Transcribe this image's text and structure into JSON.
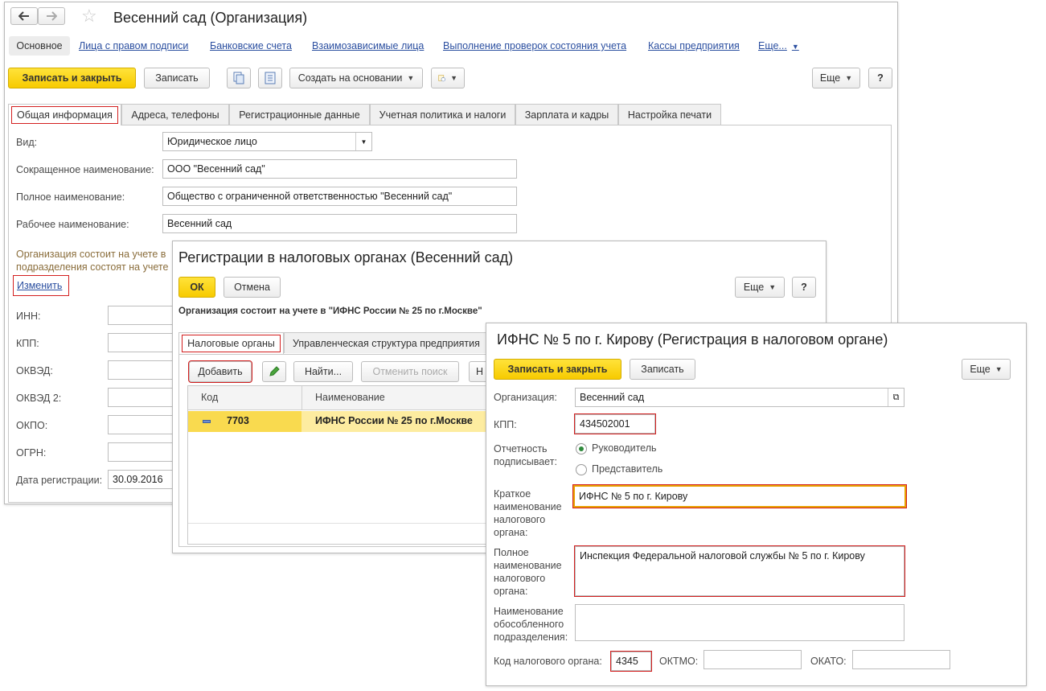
{
  "main": {
    "title": "Весенний сад (Организация)",
    "nav_links": [
      "Основное",
      "Лица с правом подписи",
      "Банковские счета",
      "Взаимозависимые лица",
      "Выполнение проверок состояния учета",
      "Кассы предприятия",
      "Еще..."
    ],
    "toolbar": {
      "save_close": "Записать и закрыть",
      "save": "Записать",
      "create_based": "Создать на основании",
      "more": "Еще",
      "help": "?"
    },
    "tabs": [
      "Общая информация",
      "Адреса, телефоны",
      "Регистрационные данные",
      "Учетная политика и налоги",
      "Зарплата и кадры",
      "Настройка печати"
    ],
    "form": {
      "kind_label": "Вид:",
      "kind_value": "Юридическое лицо",
      "short_name_label": "Сокращенное наименование:",
      "short_name_value": "ООО \"Весенний сад\"",
      "full_name_label": "Полное наименование:",
      "full_name_value": "Общество с ограниченной ответственностью \"Весенний сад\"",
      "work_name_label": "Рабочее наименование:",
      "work_name_value": "Весенний сад",
      "tax_note_line1": "Организация состоит на учете в",
      "tax_note_line2": "подразделения состоят на учете",
      "change_link": "Изменить",
      "inn_label": "ИНН:",
      "kpp_label": "КПП:",
      "okved_label": "ОКВЭД:",
      "okved2_label": "ОКВЭД 2:",
      "okpo_label": "ОКПО:",
      "ogrn_label": "ОГРН:",
      "reg_date_label": "Дата регистрации:",
      "reg_date_value": "30.09.2016"
    }
  },
  "reg": {
    "title": "Регистрации в налоговых органах (Весенний сад)",
    "ok": "ОК",
    "cancel": "Отмена",
    "more": "Еще",
    "help": "?",
    "note": "Организация состоит на учете в \"ИФНС России № 25 по г.Москве\"",
    "tabs": [
      "Налоговые органы",
      "Управленческая структура предприятия"
    ],
    "add": "Добавить",
    "find": "Найти...",
    "cancel_search": "Отменить поиск",
    "more_cut": "Н",
    "col_code": "Код",
    "col_name": "Наименование",
    "row": {
      "code": "7703",
      "name": "ИФНС России № 25 по г.Москве"
    }
  },
  "ifns": {
    "title": "ИФНС № 5 по г. Кирову (Регистрация в налоговом органе)",
    "save_close": "Записать и закрыть",
    "save": "Записать",
    "more": "Еще",
    "org_label": "Организация:",
    "org_value": "Весенний сад",
    "kpp_label": "КПП:",
    "kpp_value": "434502001",
    "signer_label_1": "Отчетность",
    "signer_label_2": "подписывает:",
    "signer_opt1": "Руководитель",
    "signer_opt2": "Представитель",
    "short_label": [
      "Краткое",
      "наименование",
      "налогового",
      "органа:"
    ],
    "short_value": "ИФНС № 5 по г. Кирову",
    "full_label": [
      "Полное",
      "наименование",
      "налогового",
      "органа:"
    ],
    "full_value": "Инспекция Федеральной налоговой службы № 5 по г. Кирову",
    "branch_label": [
      "Наименование",
      "обособленного",
      "подразделения:"
    ],
    "code_label": "Код налогового органа:",
    "code_value": "4345",
    "oktmo_label": "ОКТМО:",
    "okato_label": "ОКАТО:"
  }
}
